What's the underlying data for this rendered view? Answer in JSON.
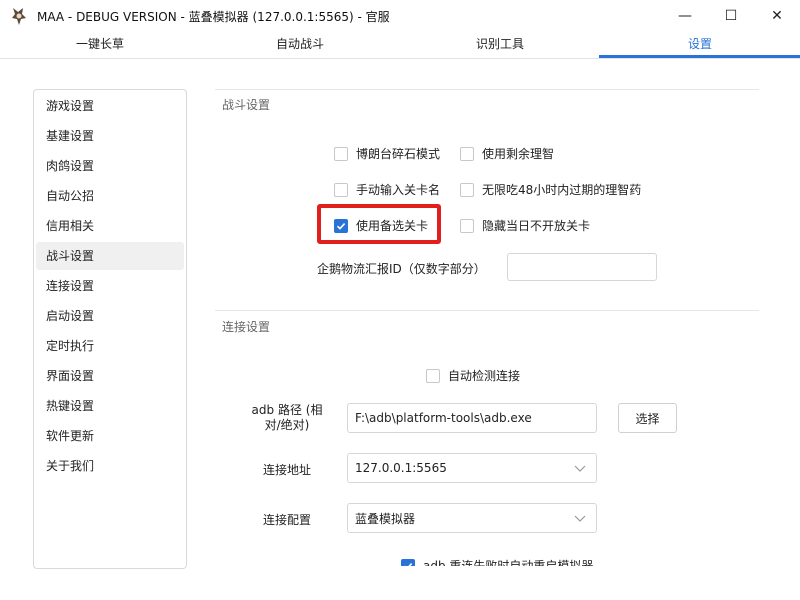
{
  "window": {
    "title": "MAA - DEBUG VERSION - 蓝叠模拟器 (127.0.0.1:5565) - 官服",
    "minimize_glyph": "—",
    "maximize_glyph": "☐",
    "close_glyph": "✕"
  },
  "tabs": [
    {
      "label": "一键长草"
    },
    {
      "label": "自动战斗"
    },
    {
      "label": "识别工具"
    },
    {
      "label": "设置"
    }
  ],
  "sidebar": {
    "items": [
      {
        "label": "游戏设置"
      },
      {
        "label": "基建设置"
      },
      {
        "label": "肉鸽设置"
      },
      {
        "label": "自动公招"
      },
      {
        "label": "信用相关"
      },
      {
        "label": "战斗设置"
      },
      {
        "label": "连接设置"
      },
      {
        "label": "启动设置"
      },
      {
        "label": "定时执行"
      },
      {
        "label": "界面设置"
      },
      {
        "label": "热键设置"
      },
      {
        "label": "软件更新"
      },
      {
        "label": "关于我们"
      }
    ],
    "active": "战斗设置"
  },
  "battle": {
    "section_title": "战斗设置",
    "options": [
      {
        "label": "博朗台碎石模式",
        "checked": false
      },
      {
        "label": "使用剩余理智",
        "checked": false
      },
      {
        "label": "手动输入关卡名",
        "checked": false
      },
      {
        "label": "无限吃48小时内过期的理智药",
        "checked": false
      },
      {
        "label": "使用备选关卡",
        "checked": true
      },
      {
        "label": "隐藏当日不开放关卡",
        "checked": false
      }
    ],
    "penguin_label": "企鹅物流汇报ID（仅数字部分）",
    "penguin_value": ""
  },
  "connection": {
    "section_title": "连接设置",
    "auto_detect": {
      "label": "自动检测连接",
      "checked": false
    },
    "adb_path_label": "adb 路径 (相对/绝对)",
    "adb_path_value": "F:\\adb\\platform-tools\\adb.exe",
    "select_button": "选择",
    "address_label": "连接地址",
    "address_value": "127.0.0.1:5565",
    "config_label": "连接配置",
    "config_value": "蓝叠模拟器",
    "restart_option": {
      "label": "adb 重连失败时自动重启模拟器",
      "checked": true
    }
  },
  "colors": {
    "accent": "#2a73d6",
    "highlight": "#e0201c"
  }
}
